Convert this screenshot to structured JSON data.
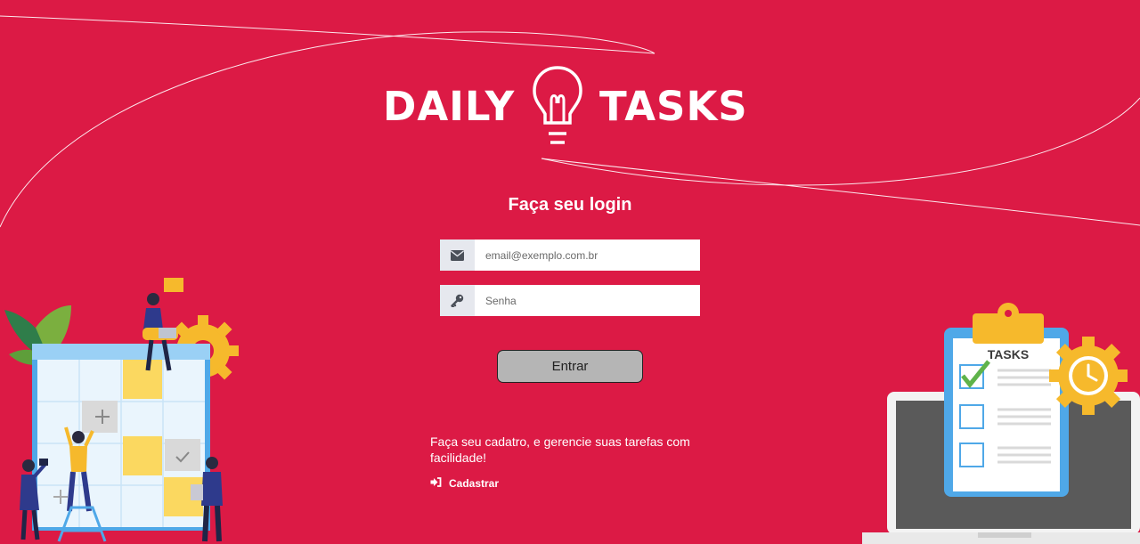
{
  "brand": {
    "left_word": "DAILY",
    "right_word": "TASKS",
    "icon": "lightbulb-icon"
  },
  "login": {
    "title": "Faça seu login",
    "email_placeholder": "email@exemplo.com.br",
    "email_icon": "envelope-icon",
    "password_placeholder": "Senha",
    "password_icon": "key-icon",
    "submit_label": "Entrar"
  },
  "signup": {
    "text": "Faça seu cadatro, e gerencie suas tarefas com facilidade!",
    "link_label": "Cadastrar",
    "link_icon": "sign-in-icon"
  },
  "clipboard": {
    "heading": "TASKS"
  },
  "colors": {
    "background": "#DC1A45",
    "accent_yellow": "#F6B92C",
    "button_gray": "#B5B5B5"
  }
}
